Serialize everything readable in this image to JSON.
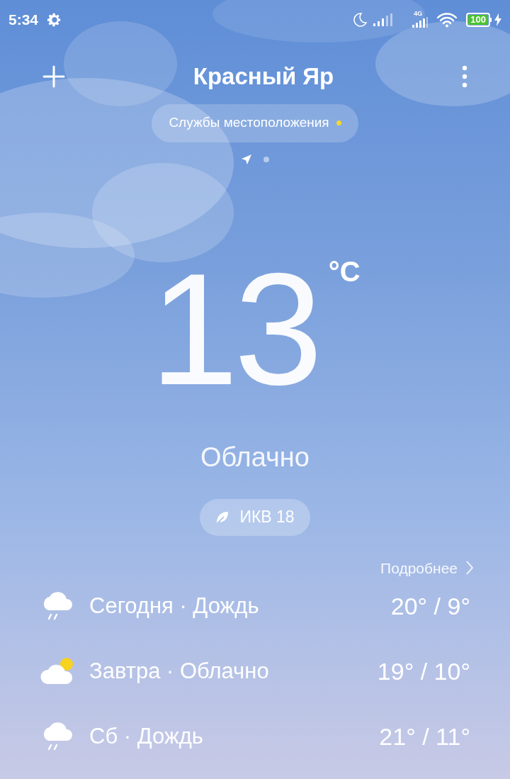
{
  "status_bar": {
    "time": "5:34",
    "network": "4G",
    "battery": "100",
    "charging": true
  },
  "header": {
    "city": "Красный Яр"
  },
  "location_services": {
    "label": "Службы местоположения",
    "active": true
  },
  "pages": [
    {
      "kind": "location",
      "selected": true
    },
    {
      "kind": "dot",
      "selected": false
    }
  ],
  "current": {
    "temperature": "13",
    "unit": "°C",
    "condition": "Облачно",
    "aqi": "ИКВ 18"
  },
  "details_link": "Подробнее",
  "forecast": [
    {
      "kind": "rain",
      "label": "Сегодня · Дождь",
      "temps": "20° / 9°"
    },
    {
      "kind": "cloud_sun",
      "label": "Завтра · Облачно",
      "temps": "19° / 10°"
    },
    {
      "kind": "rain",
      "label": "Сб · Дождь",
      "temps": "21° / 11°"
    }
  ]
}
